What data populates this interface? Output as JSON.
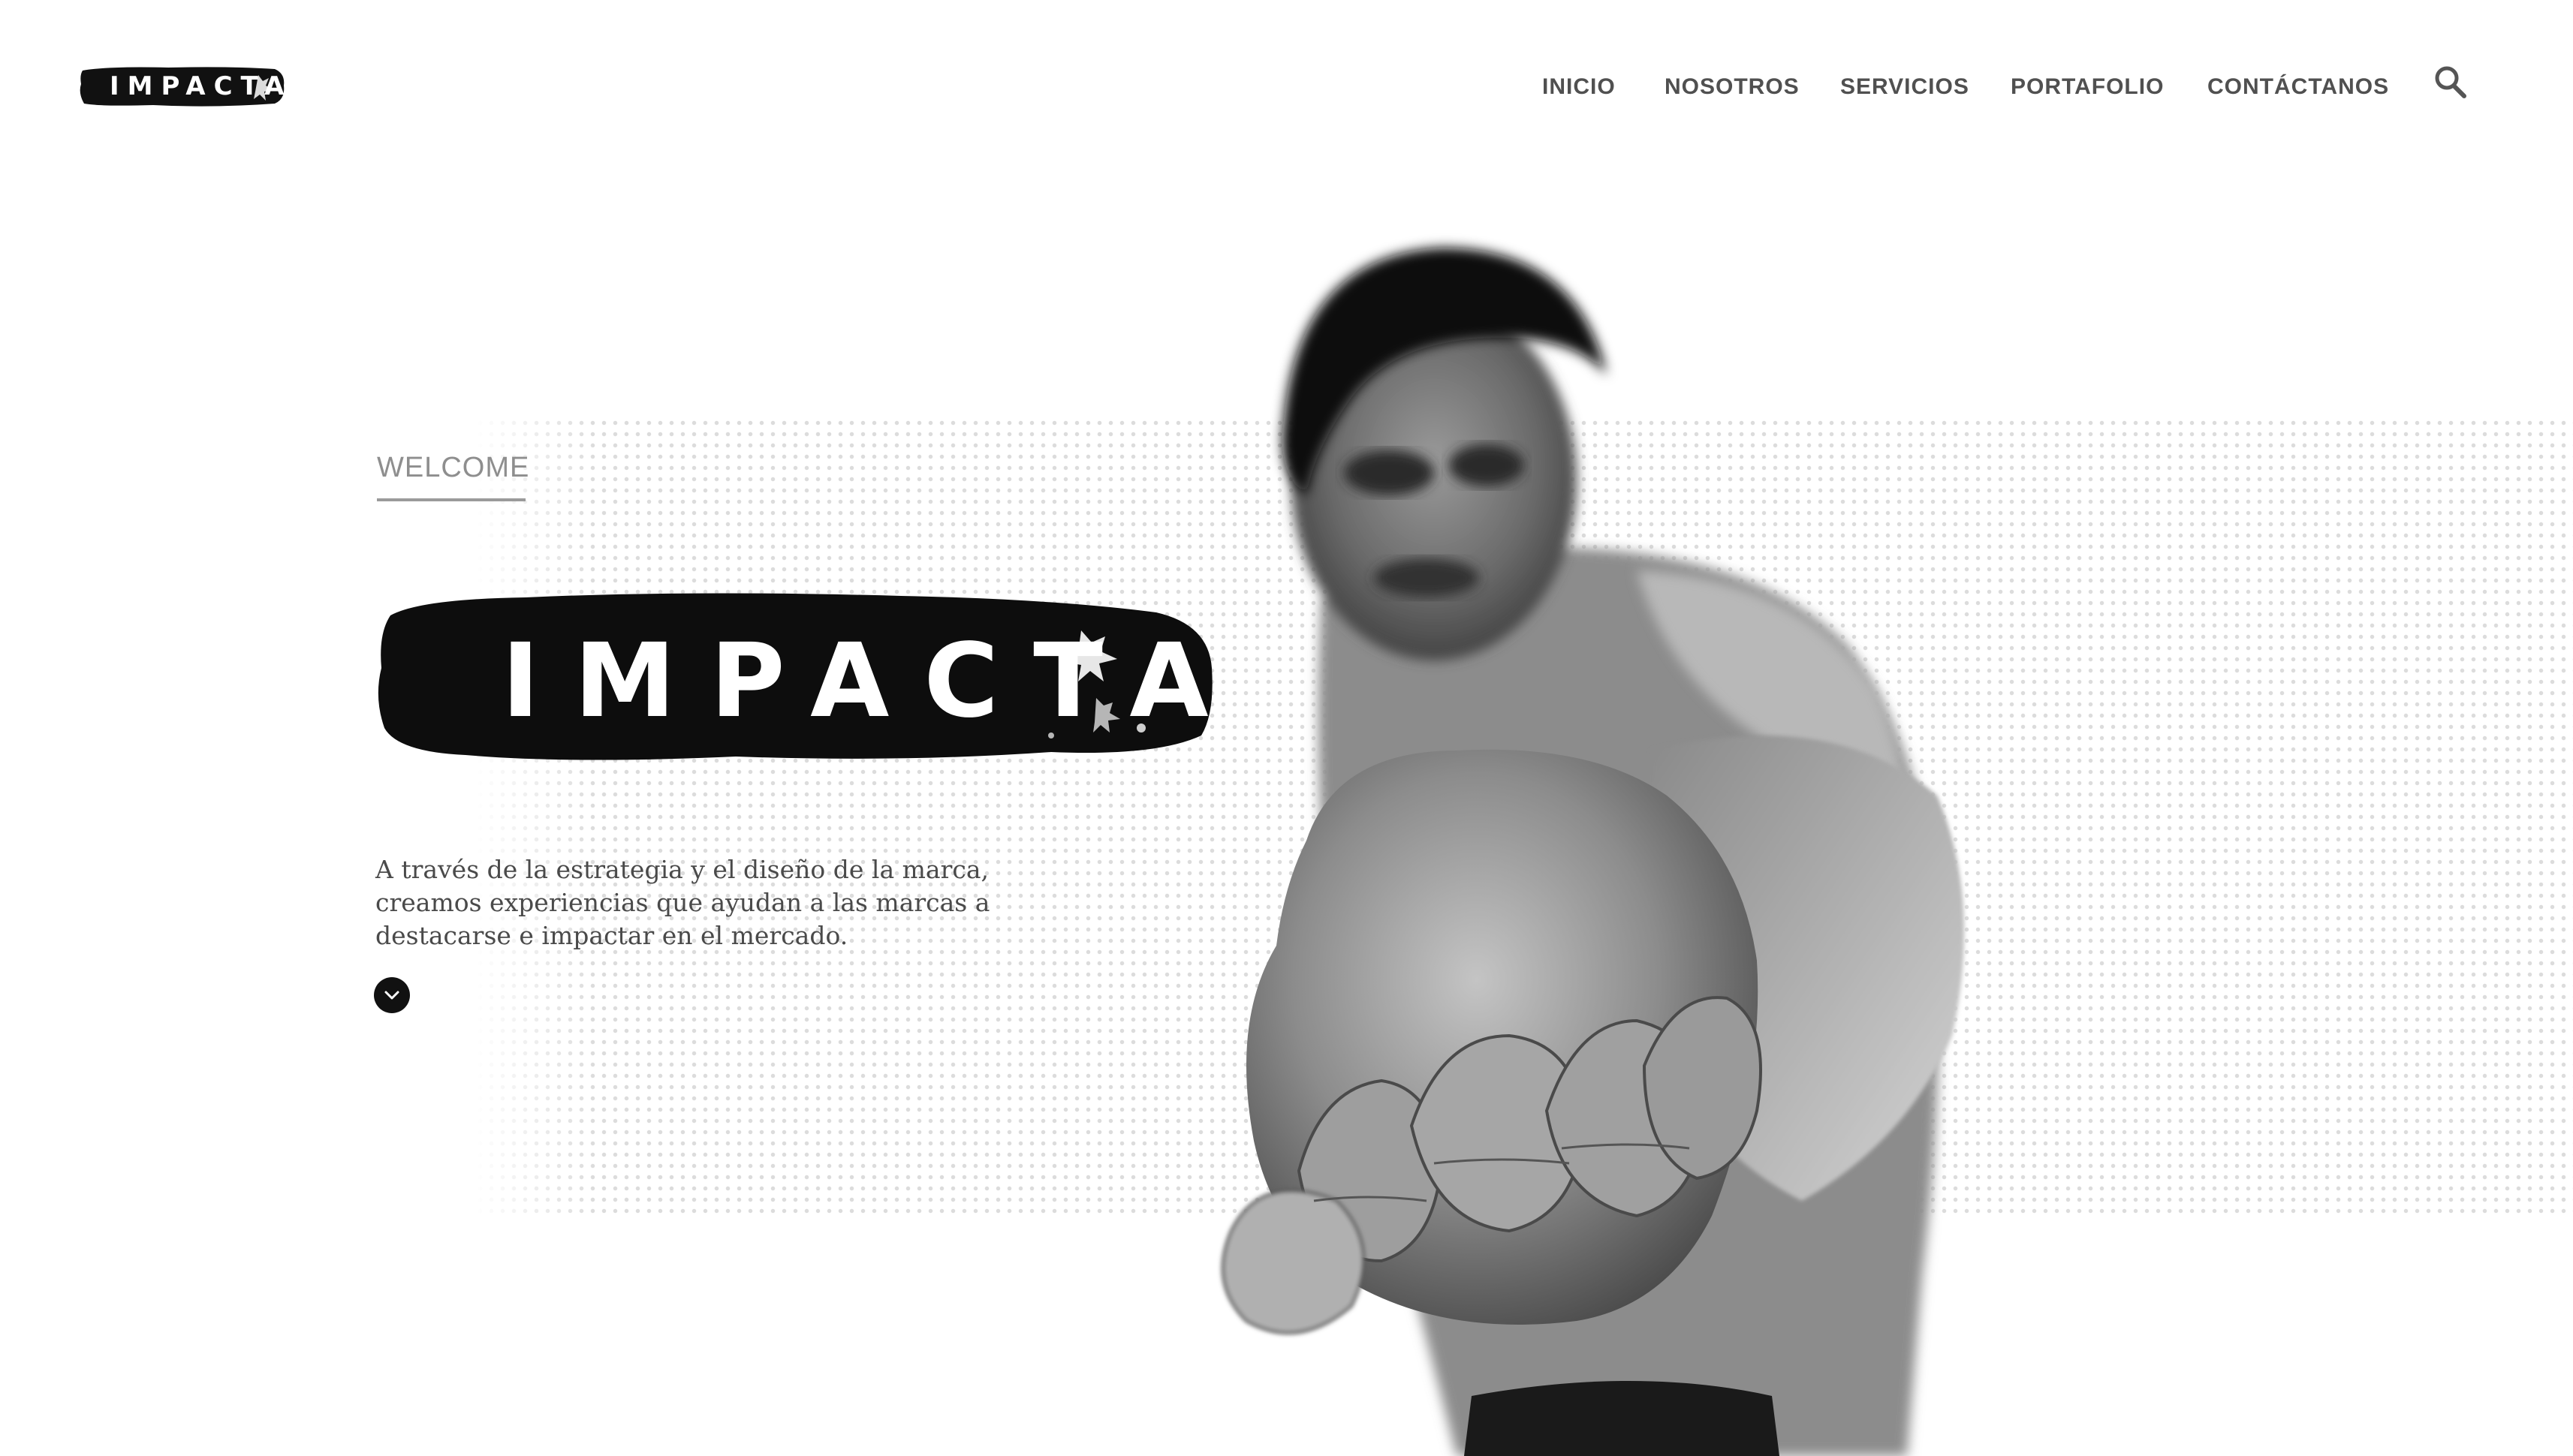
{
  "header": {
    "logo_text": "IMPACTA",
    "nav": [
      {
        "label": "INICIO"
      },
      {
        "label": "NOSOTROS"
      },
      {
        "label": "SERVICIOS"
      },
      {
        "label": "PORTAFOLIO"
      },
      {
        "label": "CONTÁCTANOS"
      }
    ],
    "search_icon": "search-icon"
  },
  "hero": {
    "eyebrow": "WELCOME",
    "brand": "IMPACTA",
    "description": "A través de la estrategia y el diseño de la marca, creamos experiencias que ayudan a las marcas a destacarse e impactar en el mercado.",
    "scroll_icon": "chevron-down-icon",
    "photo": "boxer-punch-photo"
  },
  "colors": {
    "accent": "#111111",
    "nav_text": "#505050",
    "body_text": "#4a4a4a",
    "muted": "#8e8e8e",
    "background": "#ffffff"
  }
}
